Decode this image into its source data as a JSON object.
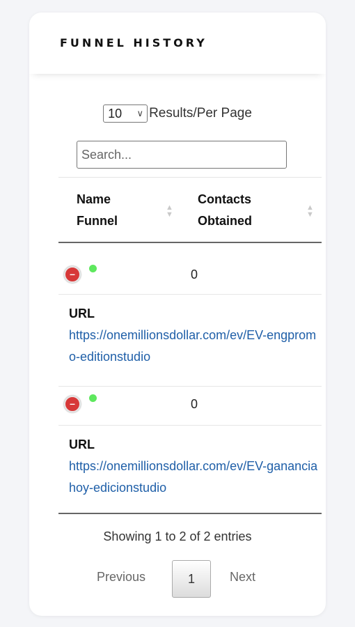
{
  "panel": {
    "title": "FUNNEL HISTORY"
  },
  "length": {
    "selected": "10",
    "label": "Results/Per Page"
  },
  "search": {
    "placeholder": "Search..."
  },
  "table": {
    "columns": [
      "Name Funnel",
      "Contacts Obtained"
    ],
    "rows": [
      {
        "contacts": "0",
        "url_label": "URL",
        "url": "https://onemillionsdollar.com/ev/EV-engpromo-editionstudio"
      },
      {
        "contacts": "0",
        "url_label": "URL",
        "url": "https://onemillionsdollar.com/ev/EV-gananciahoy-edicionstudio"
      }
    ]
  },
  "info": "Showing 1 to 2 of 2 entries",
  "pagination": {
    "previous": "Previous",
    "current": "1",
    "next": "Next"
  },
  "colors": {
    "status_active": "#5ee85e",
    "expand_button": "#d73838",
    "link": "#1f5fa8"
  }
}
